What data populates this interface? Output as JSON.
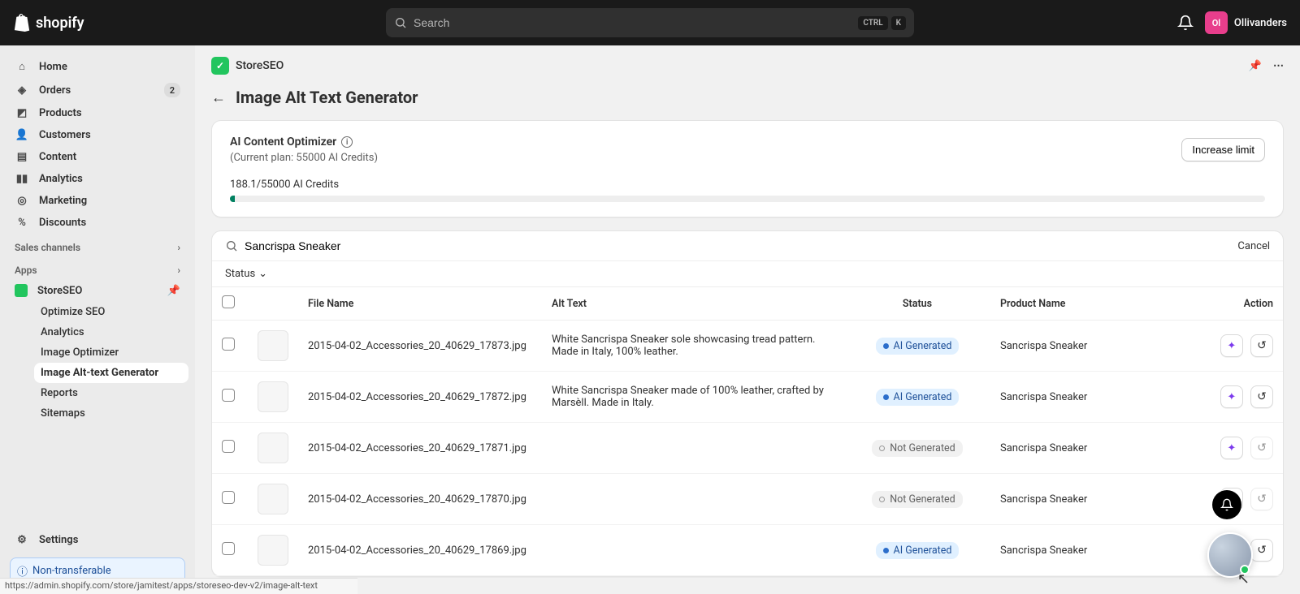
{
  "topbar": {
    "brand": "shopify",
    "search_placeholder": "Search",
    "kbd1": "CTRL",
    "kbd2": "K",
    "user_initials": "Ol",
    "user_name": "Ollivanders"
  },
  "sidebar": {
    "items": [
      {
        "label": "Home"
      },
      {
        "label": "Orders",
        "badge": "2"
      },
      {
        "label": "Products"
      },
      {
        "label": "Customers"
      },
      {
        "label": "Content"
      },
      {
        "label": "Analytics"
      },
      {
        "label": "Marketing"
      },
      {
        "label": "Discounts"
      }
    ],
    "sections": {
      "sales": "Sales channels",
      "apps": "Apps"
    },
    "app_name": "StoreSEO",
    "subitems": [
      {
        "label": "Optimize SEO"
      },
      {
        "label": "Analytics"
      },
      {
        "label": "Image Optimizer"
      },
      {
        "label": "Image Alt-text Generator"
      },
      {
        "label": "Reports"
      },
      {
        "label": "Sitemaps"
      }
    ],
    "settings": "Settings",
    "non_transferable": "Non-transferable"
  },
  "app": {
    "name": "StoreSEO",
    "page_title": "Image Alt Text Generator",
    "optimizer": {
      "title": "AI Content Optimizer",
      "plan": "(Current plan: 55000 AI Credits)",
      "credits": "188.1/55000 AI Credits",
      "increase_btn": "Increase limit"
    },
    "table": {
      "search_value": "Sancrispa Sneaker",
      "cancel": "Cancel",
      "status_filter": "Status",
      "headers": {
        "file": "File Name",
        "alt": "Alt Text",
        "status": "Status",
        "product": "Product Name",
        "action": "Action"
      },
      "status_labels": {
        "generated": "AI Generated",
        "not_generated": "Not Generated"
      },
      "rows": [
        {
          "file": "2015-04-02_Accessories_20_40629_17873.jpg",
          "alt": "White Sancrispa Sneaker sole showcasing tread pattern. Made in Italy, 100% leather.",
          "status": "generated",
          "product": "Sancrispa Sneaker",
          "undo_enabled": true
        },
        {
          "file": "2015-04-02_Accessories_20_40629_17872.jpg",
          "alt": "White Sancrispa Sneaker made of 100% leather, crafted by Marsèll. Made in Italy.",
          "status": "generated",
          "product": "Sancrispa Sneaker",
          "undo_enabled": true
        },
        {
          "file": "2015-04-02_Accessories_20_40629_17871.jpg",
          "alt": "",
          "status": "not_generated",
          "product": "Sancrispa Sneaker",
          "undo_enabled": false
        },
        {
          "file": "2015-04-02_Accessories_20_40629_17870.jpg",
          "alt": "",
          "status": "not_generated",
          "product": "Sancrispa Sneaker",
          "undo_enabled": false
        },
        {
          "file": "2015-04-02_Accessories_20_40629_17869.jpg",
          "alt": "",
          "status": "generated",
          "product": "Sancrispa Sneaker",
          "undo_enabled": true
        }
      ]
    }
  },
  "statusbar": "https://admin.shopify.com/store/jamitest/apps/storeseo-dev-v2/image-alt-text"
}
